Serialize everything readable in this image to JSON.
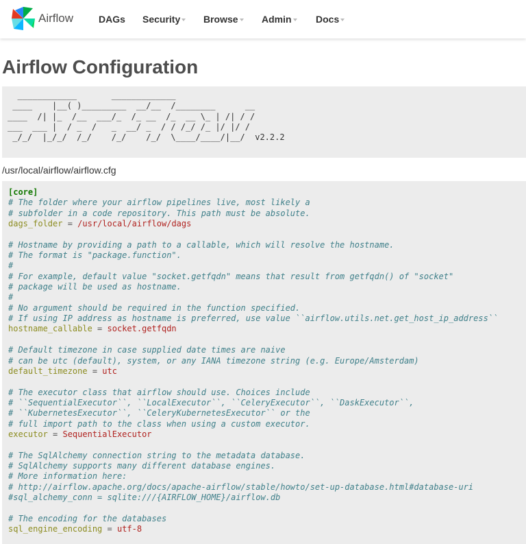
{
  "navbar": {
    "brand": "Airflow",
    "items": [
      {
        "label": "DAGs",
        "dropdown": false
      },
      {
        "label": "Security",
        "dropdown": true
      },
      {
        "label": "Browse",
        "dropdown": true
      },
      {
        "label": "Admin",
        "dropdown": true
      },
      {
        "label": "Docs",
        "dropdown": true
      }
    ]
  },
  "page": {
    "title": "Airflow Configuration",
    "ascii_logo": "  ____________       _____________\n ____    |__( )_________  __/__  /________      __\n____  /| |_  /__  ___/_  /_ __  /_  __ \\_ | /| / /\n___  ___ |  / _  /   _  __/ _  / / /_/ /_ |/ |/ /\n _/_/  |_/_/  /_/    /_/    /_/  \\____/____/|__/  v2.2.2",
    "config_path": "/usr/local/airflow/airflow.cfg"
  },
  "config": [
    {
      "type": "section",
      "text": "[core]"
    },
    {
      "type": "comment",
      "text": "# The folder where your airflow pipelines live, most likely a"
    },
    {
      "type": "comment",
      "text": "# subfolder in a code repository. This path must be absolute."
    },
    {
      "type": "kv",
      "key": "dags_folder",
      "value": "/usr/local/airflow/dags"
    },
    {
      "type": "blank"
    },
    {
      "type": "comment",
      "text": "# Hostname by providing a path to a callable, which will resolve the hostname."
    },
    {
      "type": "comment",
      "text": "# The format is \"package.function\"."
    },
    {
      "type": "comment",
      "text": "#"
    },
    {
      "type": "comment",
      "text": "# For example, default value \"socket.getfqdn\" means that result from getfqdn() of \"socket\""
    },
    {
      "type": "comment",
      "text": "# package will be used as hostname."
    },
    {
      "type": "comment",
      "text": "#"
    },
    {
      "type": "comment",
      "text": "# No argument should be required in the function specified."
    },
    {
      "type": "comment",
      "text": "# If using IP address as hostname is preferred, use value ``airflow.utils.net.get_host_ip_address``"
    },
    {
      "type": "kv",
      "key": "hostname_callable",
      "value": "socket.getfqdn"
    },
    {
      "type": "blank"
    },
    {
      "type": "comment",
      "text": "# Default timezone in case supplied date times are naive"
    },
    {
      "type": "comment",
      "text": "# can be utc (default), system, or any IANA timezone string (e.g. Europe/Amsterdam)"
    },
    {
      "type": "kv",
      "key": "default_timezone",
      "value": "utc"
    },
    {
      "type": "blank"
    },
    {
      "type": "comment",
      "text": "# The executor class that airflow should use. Choices include"
    },
    {
      "type": "comment",
      "text": "# ``SequentialExecutor``, ``LocalExecutor``, ``CeleryExecutor``, ``DaskExecutor``,"
    },
    {
      "type": "comment",
      "text": "# ``KubernetesExecutor``, ``CeleryKubernetesExecutor`` or the"
    },
    {
      "type": "comment",
      "text": "# full import path to the class when using a custom executor."
    },
    {
      "type": "kv",
      "key": "executor",
      "value": "SequentialExecutor"
    },
    {
      "type": "blank"
    },
    {
      "type": "comment",
      "text": "# The SqlAlchemy connection string to the metadata database."
    },
    {
      "type": "comment",
      "text": "# SqlAlchemy supports many different database engines."
    },
    {
      "type": "comment",
      "text": "# More information here:"
    },
    {
      "type": "comment",
      "text": "# http://airflow.apache.org/docs/apache-airflow/stable/howto/set-up-database.html#database-uri"
    },
    {
      "type": "comment",
      "text": "#sql_alchemy_conn = sqlite:///{AIRFLOW_HOME}/airflow.db"
    },
    {
      "type": "blank"
    },
    {
      "type": "comment",
      "text": "# The encoding for the databases"
    },
    {
      "type": "kv",
      "key": "sql_engine_encoding",
      "value": "utf-8"
    }
  ]
}
